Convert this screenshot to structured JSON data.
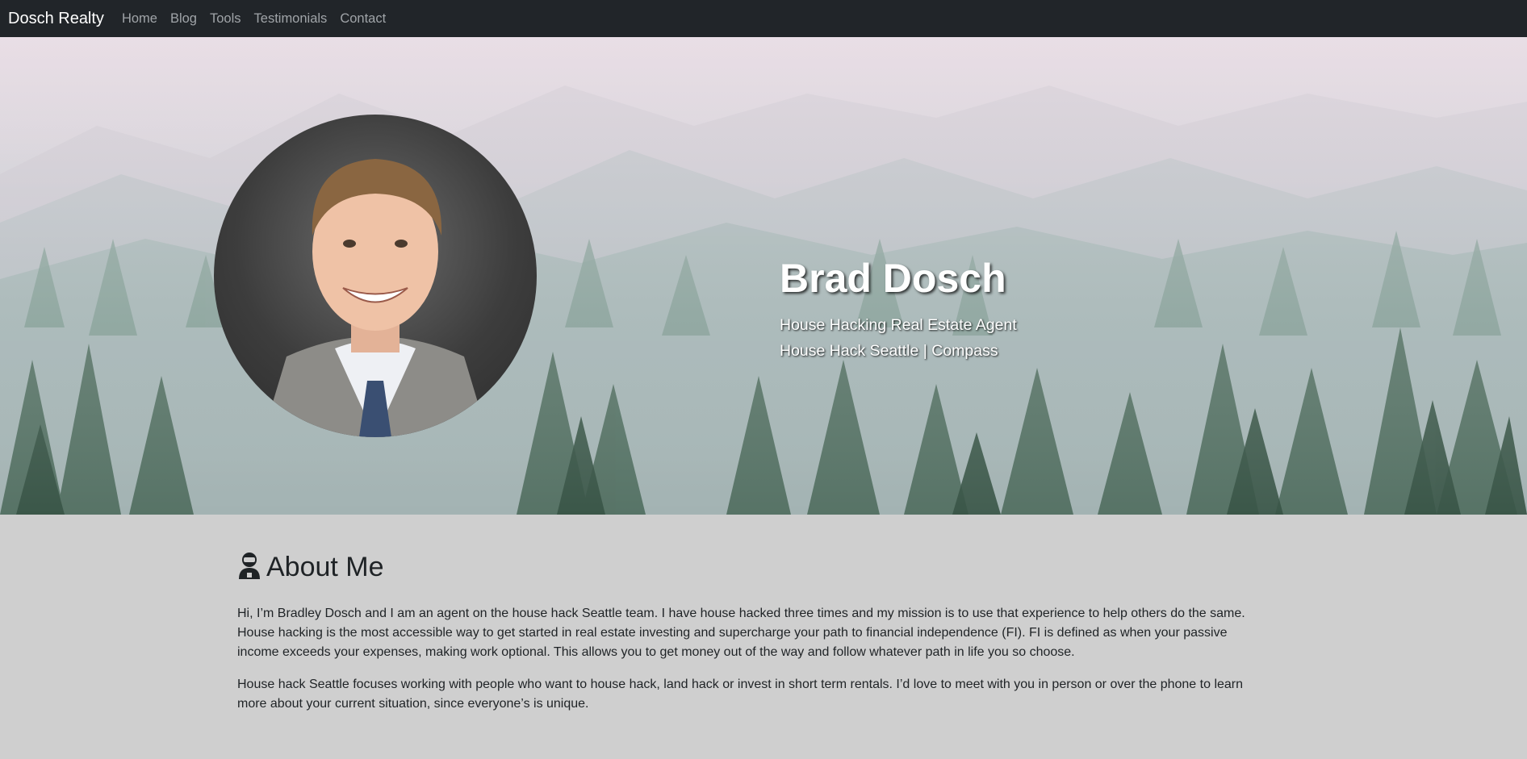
{
  "navbar": {
    "brand": "Dosch Realty",
    "links": [
      "Home",
      "Blog",
      "Tools",
      "Testimonials",
      "Contact"
    ]
  },
  "hero": {
    "name": "Brad Dosch",
    "subtitle_1": "House Hacking Real Estate Agent",
    "subtitle_2": "House Hack Seattle | Compass"
  },
  "about": {
    "icon": "person-icon",
    "title": "About Me",
    "paragraphs": [
      "Hi, I’m Bradley Dosch and I am an agent on the house hack Seattle team. I have house hacked three times and my mission is to use that experience to help others do the same. House hacking is the most accessible way to get started in real estate investing and supercharge your path to financial independence (FI). FI is defined as when your passive income exceeds your expenses, making work optional. This allows you to get money out of the way and follow whatever path in life you so choose.",
      "House hack Seattle focuses working with people who want to house hack, land hack or invest in short term rentals. I’d love to meet with you in person or over the phone to learn more about your current situation, since everyone’s is unique."
    ]
  },
  "colors": {
    "navbar_bg": "#212529",
    "page_bg": "#cfcfcf",
    "nav_link": "#a0a4a8"
  }
}
